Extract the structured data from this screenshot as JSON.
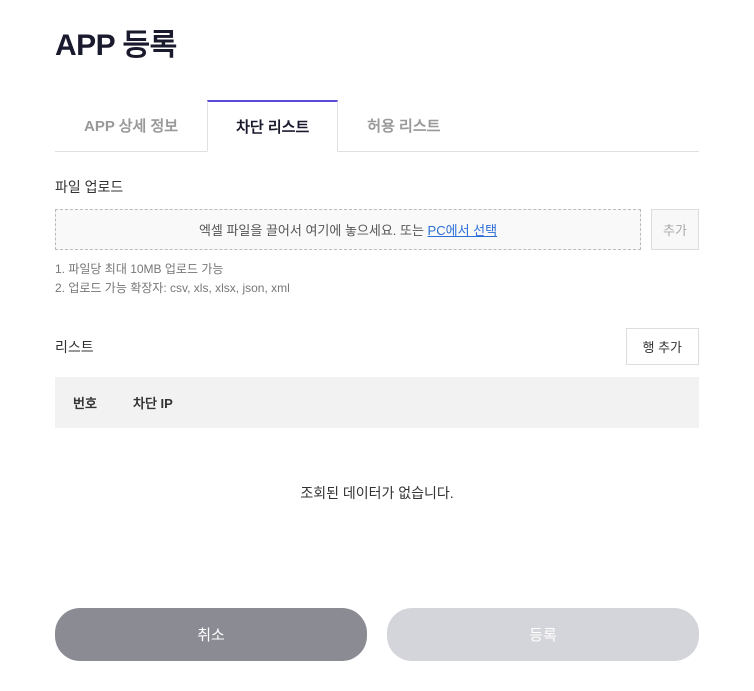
{
  "page": {
    "title": "APP 등록"
  },
  "tabs": [
    {
      "label": "APP 상세 정보",
      "active": false
    },
    {
      "label": "차단 리스트",
      "active": true
    },
    {
      "label": "허용 리스트",
      "active": false
    }
  ],
  "upload": {
    "section_label": "파일 업로드",
    "dropzone_prefix": "엑셀 파일을 끌어서 여기에 놓으세요. 또는 ",
    "dropzone_link": "PC에서 선택",
    "add_button": "추가",
    "hints": [
      "1. 파일당 최대 10MB 업로드 가능",
      "2. 업로드 가능 확장자: csv, xls, xlsx, json, xml"
    ]
  },
  "list": {
    "section_label": "리스트",
    "add_row_button": "행 추가",
    "columns": {
      "number": "번호",
      "blocked_ip": "차단 IP"
    },
    "rows": [],
    "empty_message": "조회된 데이터가 없습니다."
  },
  "footer": {
    "cancel": "취소",
    "submit": "등록"
  }
}
